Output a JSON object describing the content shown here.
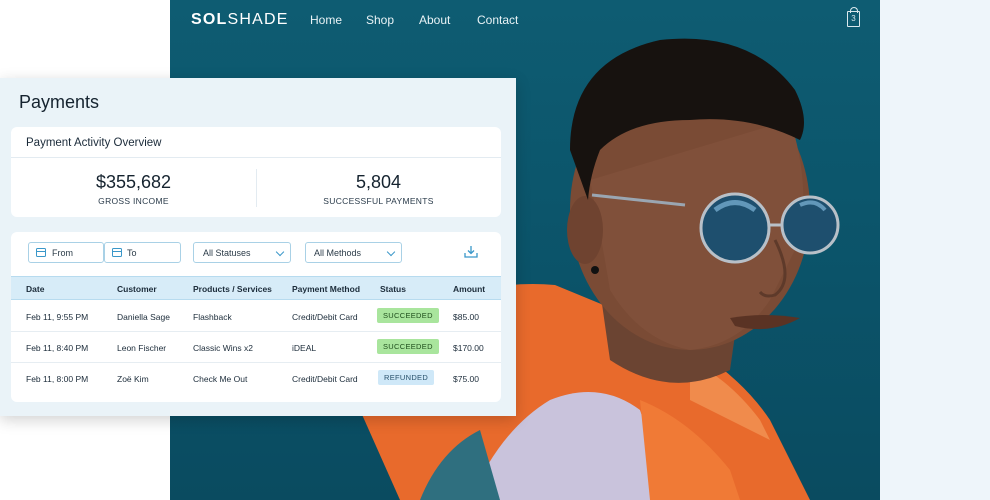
{
  "site": {
    "logo_bold": "SOL",
    "logo_light": "SHADE",
    "nav": [
      "Home",
      "Shop",
      "About",
      "Contact"
    ],
    "cart_count": "3",
    "colors": {
      "background": "#0e5c72",
      "jacket": "#f06a2a"
    }
  },
  "payments": {
    "title": "Payments",
    "overview": {
      "title": "Payment Activity Overview",
      "gross_income_value": "$355,682",
      "gross_income_label": "GROSS INCOME",
      "successful_value": "5,804",
      "successful_label": "SUCCESSFUL PAYMENTS"
    },
    "filters": {
      "from": "From",
      "to": "To",
      "statuses": "All Statuses",
      "methods": "All Methods"
    },
    "columns": [
      "Date",
      "Customer",
      "Products / Services",
      "Payment Method",
      "Status",
      "Amount"
    ],
    "rows": [
      {
        "date": "Feb 11, 9:55 PM",
        "customer": "Daniella Sage",
        "product": "Flashback",
        "method": "Credit/Debit Card",
        "status": "SUCCEEDED",
        "amount": "$85.00"
      },
      {
        "date": "Feb 11, 8:40 PM",
        "customer": "Leon Fischer",
        "product": "Classic Wins x2",
        "method": "iDEAL",
        "status": "SUCCEEDED",
        "amount": "$170.00"
      },
      {
        "date": "Feb 11, 8:00 PM",
        "customer": "Zoë Kim",
        "product": "Check Me Out",
        "method": "Credit/Debit Card",
        "status": "REFUNDED",
        "amount": "$75.00"
      }
    ],
    "colors": {
      "succeeded": "#a9e59d",
      "refunded": "#cfe8f8",
      "header": "#d7ecf8"
    }
  }
}
